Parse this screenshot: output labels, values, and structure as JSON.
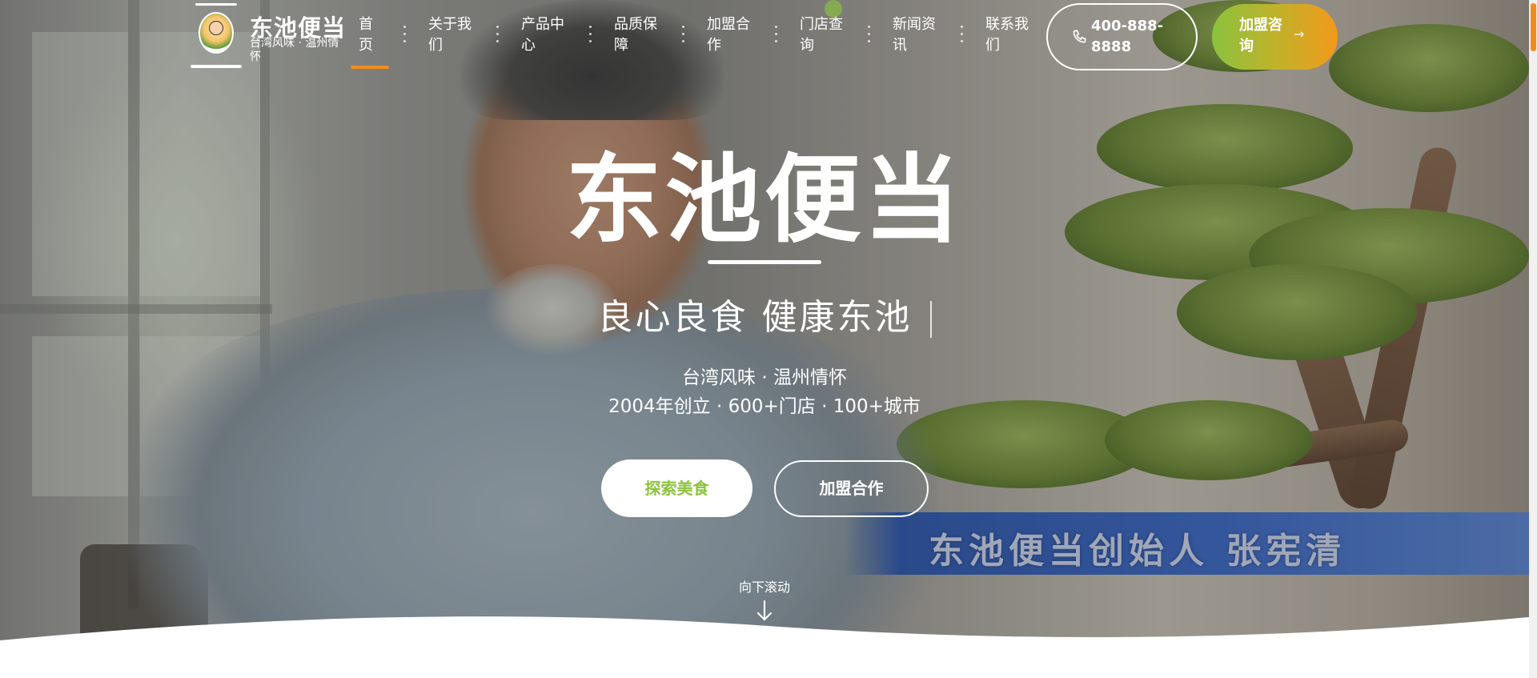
{
  "brand": {
    "name": "东池便当",
    "tagline": "台湾风味 · 温州情怀",
    "logo_icon": "mascot-logo-icon"
  },
  "nav": {
    "items": [
      {
        "label": "首页",
        "active": true
      },
      {
        "label": "关于我们",
        "active": false
      },
      {
        "label": "产品中心",
        "active": false
      },
      {
        "label": "品质保障",
        "active": false
      },
      {
        "label": "加盟合作",
        "active": false
      },
      {
        "label": "门店查询",
        "active": false
      },
      {
        "label": "新闻资讯",
        "active": false
      },
      {
        "label": "联系我们",
        "active": false
      }
    ]
  },
  "header": {
    "phone": "400-888-8888",
    "phone_icon": "phone-icon",
    "cta_label": "加盟咨询",
    "cta_icon": "arrow-right-icon"
  },
  "hero": {
    "title": "东池便当",
    "slogan": "良心良食 健康东池",
    "subtitle_1": "台湾风味 · 温州情怀",
    "subtitle_2": "2004年创立 · 600+门店 · 100+城市",
    "primary_button": "探索美食",
    "secondary_button": "加盟合作",
    "scroll_hint": "向下滚动",
    "scroll_icon": "arrow-down-icon",
    "video_caption": "东池便当创始人 张宪清"
  },
  "colors": {
    "accent_orange": "#f28d1a",
    "accent_green": "#8cc23e",
    "text_white": "#ffffff"
  }
}
